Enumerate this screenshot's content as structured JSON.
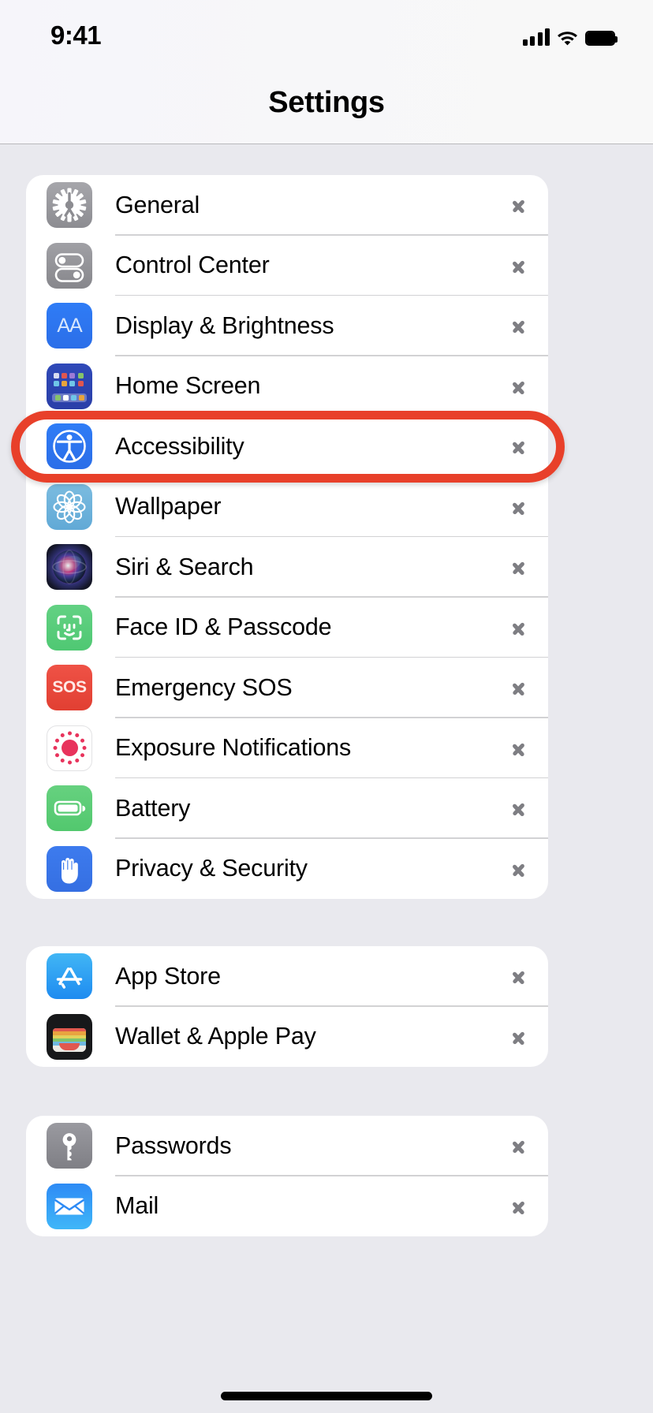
{
  "status_bar": {
    "time": "9:41",
    "cellular_icon": "cellular-bars-icon",
    "wifi_icon": "wifi-icon",
    "battery_icon": "battery-full-icon"
  },
  "header": {
    "title": "Settings"
  },
  "annotation": {
    "type": "highlight-oval",
    "color": "#E8402A",
    "target_row": "Accessibility"
  },
  "colors": {
    "page_background": "#E9E9EE",
    "card_background": "#FFFFFF",
    "separator": "#D2D2D4",
    "chevron": "#7E7E83",
    "label_text": "#000000",
    "annotation": "#E8402A"
  },
  "groups": [
    {
      "name": "system-group",
      "rows": [
        {
          "label": "General",
          "icon": "gear-icon",
          "icon_class": "ic-general",
          "chevron": "chevron-right-icon"
        },
        {
          "label": "Control Center",
          "icon": "toggles-icon",
          "icon_class": "ic-control",
          "chevron": "chevron-right-icon"
        },
        {
          "label": "Display & Brightness",
          "icon": "aa-text-icon",
          "icon_class": "ic-display",
          "chevron": "chevron-right-icon",
          "glyph_text": "AA"
        },
        {
          "label": "Home Screen",
          "icon": "app-grid-icon",
          "icon_class": "ic-home",
          "chevron": "chevron-right-icon"
        },
        {
          "label": "Accessibility",
          "icon": "accessibility-icon",
          "icon_class": "ic-access",
          "chevron": "chevron-right-icon"
        },
        {
          "label": "Wallpaper",
          "icon": "flower-icon",
          "icon_class": "ic-wall",
          "chevron": "chevron-right-icon"
        },
        {
          "label": "Siri & Search",
          "icon": "siri-orb-icon",
          "icon_class": "ic-siri",
          "chevron": "chevron-right-icon"
        },
        {
          "label": "Face ID & Passcode",
          "icon": "face-id-icon",
          "icon_class": "ic-faceid",
          "chevron": "chevron-right-icon"
        },
        {
          "label": "Emergency SOS",
          "icon": "sos-icon",
          "icon_class": "ic-sos",
          "chevron": "chevron-right-icon",
          "glyph_text": "SOS"
        },
        {
          "label": "Exposure Notifications",
          "icon": "exposure-dots-icon",
          "icon_class": "ic-expo",
          "chevron": "chevron-right-icon"
        },
        {
          "label": "Battery",
          "icon": "battery-icon",
          "icon_class": "ic-batt",
          "chevron": "chevron-right-icon"
        },
        {
          "label": "Privacy & Security",
          "icon": "hand-icon",
          "icon_class": "ic-priv",
          "chevron": "chevron-right-icon"
        }
      ]
    },
    {
      "name": "store-group",
      "rows": [
        {
          "label": "App Store",
          "icon": "app-store-icon",
          "icon_class": "ic-appstore",
          "chevron": "chevron-right-icon"
        },
        {
          "label": "Wallet & Apple Pay",
          "icon": "wallet-icon",
          "icon_class": "ic-wallet",
          "chevron": "chevron-right-icon"
        }
      ]
    },
    {
      "name": "accounts-group",
      "rows": [
        {
          "label": "Passwords",
          "icon": "key-icon",
          "icon_class": "ic-pass",
          "chevron": "chevron-right-icon"
        },
        {
          "label": "Mail",
          "icon": "envelope-icon",
          "icon_class": "ic-mail",
          "chevron": "chevron-right-icon"
        }
      ]
    }
  ]
}
